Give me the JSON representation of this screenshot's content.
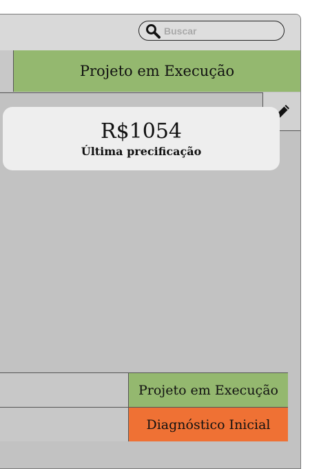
{
  "search": {
    "placeholder": "Buscar",
    "value": ""
  },
  "status_bar": {
    "current_stage": "Projeto em Execução",
    "active_color": "#94b86f"
  },
  "price_card": {
    "value": "R$1054",
    "label": "Última precificação"
  },
  "stages": [
    {
      "label": "Projeto em Execução",
      "color": "#94b86f"
    },
    {
      "label": "Diagnóstico Inicial",
      "color": "#ef7134"
    }
  ],
  "icons": {
    "search": "search-icon",
    "edit": "pencil-icon"
  }
}
